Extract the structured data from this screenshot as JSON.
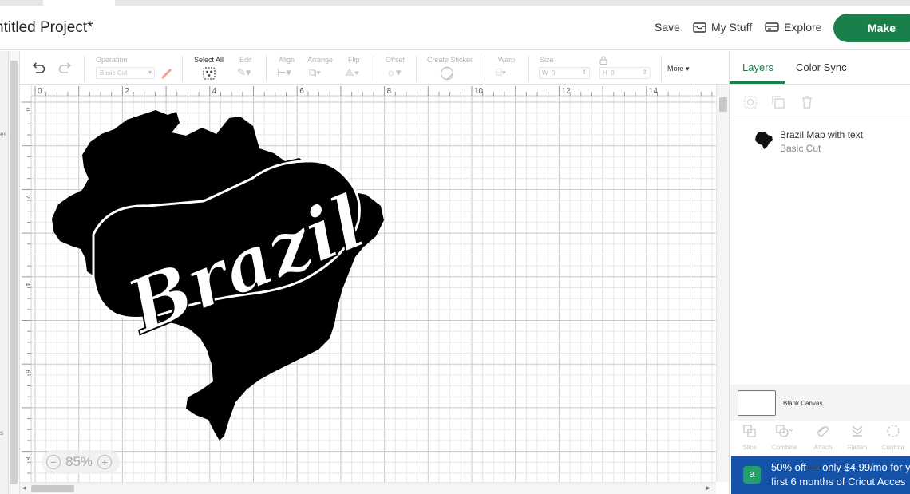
{
  "header": {
    "title": "ntitled Project*",
    "save_label": "Save",
    "mystuff_label": "My Stuff",
    "explore_label": "Explore",
    "make_label": "Make"
  },
  "left_strip_marks": [
    "es",
    "s"
  ],
  "toolbar": {
    "operation_label": "Operation",
    "operation_value": "Basic Cut",
    "select_all_label": "Select All",
    "edit_label": "Edit",
    "align_label": "Align",
    "arrange_label": "Arrange",
    "flip_label": "Flip",
    "offset_label": "Offset",
    "create_sticker_label": "Create Sticker",
    "warp_label": "Warp",
    "size_label": "Size",
    "w_label": "W",
    "w_value": "0",
    "h_label": "H",
    "h_value": "0",
    "more_label": "More"
  },
  "ruler": {
    "x_ticks": [
      "0",
      "2",
      "4",
      "6",
      "8",
      "10",
      "12",
      "14"
    ],
    "y_ticks": [
      "0",
      "2",
      "4",
      "6",
      "8"
    ]
  },
  "canvas": {
    "design_text": "Brazil",
    "zoom_label": "85%"
  },
  "panel": {
    "tabs": [
      "Layers",
      "Color Sync"
    ],
    "layer": {
      "name": "Brazil Map with text",
      "operation": "Basic Cut"
    },
    "blank_canvas_label": "Blank Canvas",
    "bottom_tools": [
      "Slice",
      "Combine",
      "Attach",
      "Flatten",
      "Contour"
    ],
    "promo_line1": "50% off — only $4.99/mo for y",
    "promo_line2": "first 6 months of Cricut Acces"
  },
  "colors": {
    "accent": "#1a7f4b",
    "promo": "#1553a8",
    "design": "#000000"
  }
}
